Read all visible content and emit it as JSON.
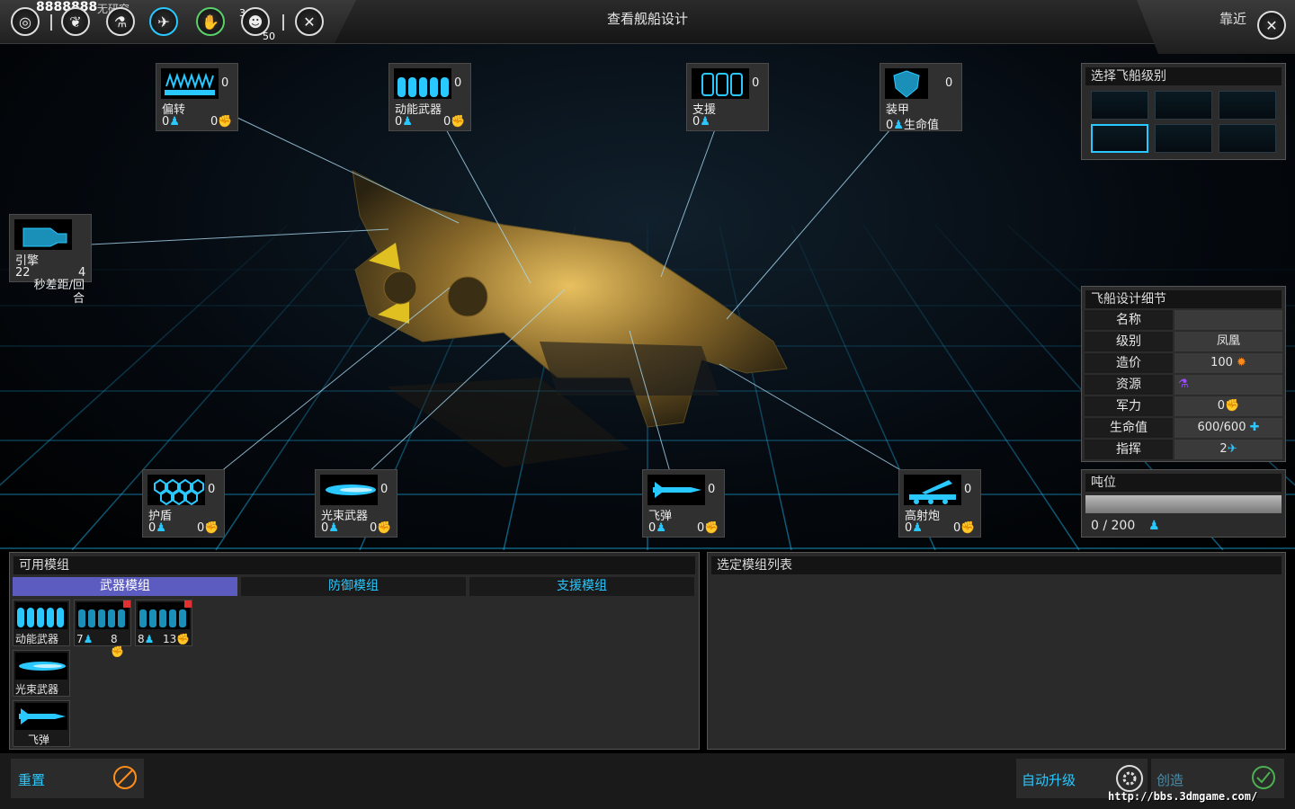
{
  "topbar": {
    "title": "查看舰船设计",
    "credits": "8888888",
    "research_status": "无研究",
    "badge_top": "3",
    "badge_bottom": "50",
    "approach_label": "靠近"
  },
  "slots": {
    "deflect": {
      "name": "偏转",
      "count": "0",
      "v1": "0",
      "v2": "0"
    },
    "kinetic": {
      "name": "动能武器",
      "count": "0",
      "v1": "0",
      "v2": "0"
    },
    "support": {
      "name": "支援",
      "count": "0",
      "v1": "0"
    },
    "armor": {
      "name": "装甲",
      "count": "0",
      "v1": "0",
      "v1_label": "生命值"
    },
    "engine": {
      "name": "引擎",
      "v1": "22",
      "v2": "4",
      "desc": "秒差距/回合"
    },
    "shield": {
      "name": "护盾",
      "count": "0",
      "v1": "0",
      "v2": "0"
    },
    "beam": {
      "name": "光束武器",
      "count": "0",
      "v1": "0",
      "v2": "0"
    },
    "missile": {
      "name": "飞弹",
      "count": "0",
      "v1": "0",
      "v2": "0"
    },
    "artillery": {
      "name": "高射炮",
      "count": "0",
      "v1": "0",
      "v2": "0"
    }
  },
  "ship_class_panel": {
    "title": "选择飞船级别"
  },
  "design_details": {
    "title": "飞船设计细节",
    "rows": [
      {
        "k": "名称",
        "v": ""
      },
      {
        "k": "级别",
        "v": "凤凰"
      },
      {
        "k": "造价",
        "v": "100"
      },
      {
        "k": "资源",
        "v": ""
      },
      {
        "k": "军力",
        "v": "0"
      },
      {
        "k": "生命值",
        "v": "600/600"
      },
      {
        "k": "指挥",
        "v": "2"
      }
    ]
  },
  "tonnage": {
    "title": "吨位",
    "value": "0 / 200",
    "fill_fraction": 0
  },
  "available_modules": {
    "title": "可用模组",
    "tabs": [
      "武器模组",
      "防御模组",
      "支援模组"
    ],
    "items": [
      {
        "name": "动能武器"
      },
      {
        "a": "7",
        "b": "8"
      },
      {
        "a": "8",
        "b": "13"
      },
      {
        "name": "光束武器"
      },
      {
        "name": "飞弹"
      }
    ]
  },
  "selected_modules": {
    "title": "选定模组列表"
  },
  "bottombar": {
    "reset": "重置",
    "auto_upgrade": "自动升级",
    "create": "创造",
    "watermark": "http://bbs.3dmgame.com/"
  },
  "colors": {
    "accent": "#29c8ff",
    "active_tab": "#5b5bc0",
    "cost": "#ff8c1a",
    "resource": "#9b4dff"
  }
}
